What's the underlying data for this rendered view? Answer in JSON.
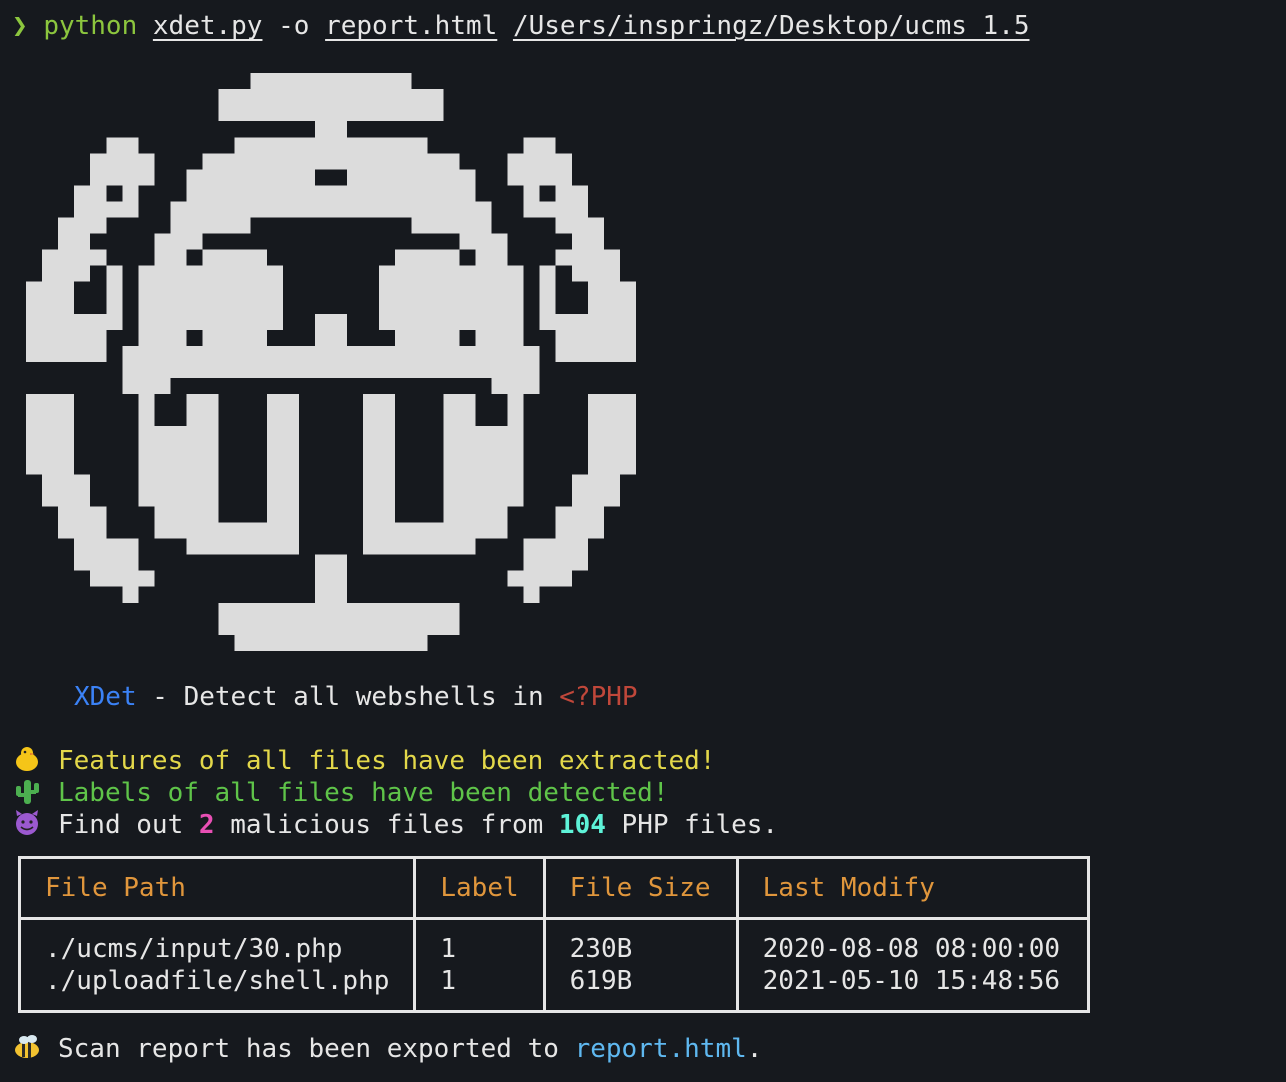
{
  "command": {
    "prompt": "❯",
    "program": "python",
    "script": "xdet.py",
    "flag": "-o",
    "output": "report.html",
    "target": "/Users/inspringz/Desktop/ucms_1.5"
  },
  "banner": {
    "name": "XDet",
    "separator": " - ",
    "tagline": "Detect all webshells in ",
    "lang": "<?PHP"
  },
  "messages": {
    "extracted": "Features of all files have been extracted!",
    "detected": "Labels of all files have been detected!",
    "find_prefix": "Find out ",
    "malicious_count": "2",
    "find_middle": " malicious files from ",
    "total_count": "104",
    "find_suffix": " PHP files.",
    "icons": [
      "chick-icon",
      "cactus-icon",
      "devil-icon",
      "bee-icon"
    ]
  },
  "table": {
    "headers": [
      "File Path",
      "Label",
      "File Size",
      "Last Modify"
    ],
    "rows": [
      [
        "./ucms/input/30.php",
        "1",
        "230B",
        "2020-08-08 08:00:00"
      ],
      [
        "./uploadfile/shell.php",
        "1",
        "619B",
        "2021-05-10 15:48:56"
      ]
    ]
  },
  "footer": {
    "prefix": "Scan report has been exported to ",
    "file": "report.html",
    "suffix": "."
  },
  "colors": {
    "background": "#16191e",
    "foreground": "#e6e6e6",
    "prompt": "#8cc63e",
    "name": "#3b82f6",
    "lang": "#c0473a",
    "extracted": "#e3d84a",
    "detected": "#5fc449",
    "malicious": "#e84fb4",
    "total": "#5ef2d8",
    "header": "#e0963c",
    "link": "#5fb8f0"
  }
}
